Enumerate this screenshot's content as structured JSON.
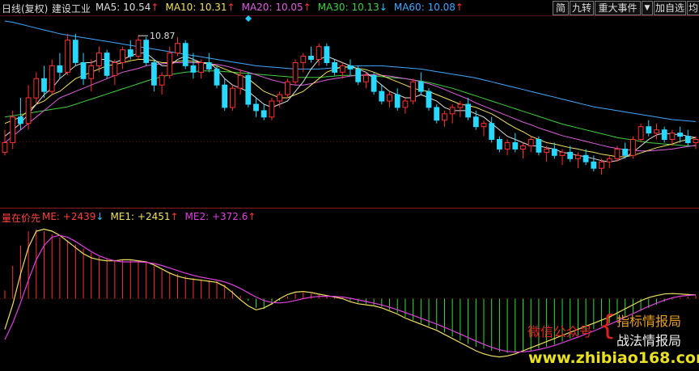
{
  "header": {
    "period": "日线(复权)",
    "stock_name": "建设工业",
    "ma": [
      {
        "label": "MA5:",
        "value": "10.54",
        "dir": "up",
        "color": "#dddddd"
      },
      {
        "label": "MA10:",
        "value": "10.31",
        "dir": "up",
        "color": "#f0e060"
      },
      {
        "label": "MA20:",
        "value": "10.05",
        "dir": "up",
        "color": "#e060e0"
      },
      {
        "label": "MA30:",
        "value": "10.13",
        "dir": "down",
        "color": "#40d040"
      },
      {
        "label": "MA60:",
        "value": "10.08",
        "dir": "up",
        "color": "#40a8ff"
      }
    ]
  },
  "toolbar": {
    "jian": "简",
    "jiuzhuan": "九转",
    "events": "重大事件",
    "add_watch": "加自选",
    "misc": "均"
  },
  "sub_panel": {
    "title": "量在价先",
    "items": [
      {
        "label": "ME:",
        "value": "+2439",
        "dir": "down",
        "color": "#ff4040"
      },
      {
        "label": "ME1:",
        "value": "+2451",
        "dir": "up",
        "color": "#f0e060"
      },
      {
        "label": "ME2:",
        "value": "+372.6",
        "dir": "up",
        "color": "#e040e0"
      }
    ]
  },
  "watermark": {
    "wechat": "微信公众号",
    "brace": "{",
    "line1": "指标情报局",
    "line2": "战法情报局",
    "site": "www.zhibiao168.com"
  },
  "chart_data": {
    "type": "candlestick",
    "annotation": "10.87",
    "colors": {
      "up": "#ff3030",
      "down": "#28d8ff",
      "ma5": "#dddddd",
      "ma10": "#f0e060",
      "ma20": "#e060e0",
      "ma30": "#40d040",
      "ma60": "#40a8ff"
    },
    "candles": [
      [
        9.05,
        9.4,
        9.0,
        9.2
      ],
      [
        9.2,
        9.7,
        9.1,
        9.6
      ],
      [
        9.6,
        9.9,
        9.4,
        9.5
      ],
      [
        9.5,
        10.1,
        9.4,
        9.9
      ],
      [
        9.9,
        10.3,
        9.8,
        10.2
      ],
      [
        10.2,
        10.4,
        9.9,
        10.0
      ],
      [
        10.0,
        10.5,
        9.95,
        10.4
      ],
      [
        10.4,
        10.6,
        10.2,
        10.3
      ],
      [
        10.3,
        10.9,
        10.25,
        10.8
      ],
      [
        10.8,
        10.9,
        10.4,
        10.45
      ],
      [
        10.45,
        10.6,
        10.1,
        10.2
      ],
      [
        10.2,
        10.5,
        10.0,
        10.4
      ],
      [
        10.4,
        10.7,
        10.3,
        10.6
      ],
      [
        10.6,
        10.65,
        10.2,
        10.25
      ],
      [
        10.25,
        10.5,
        10.1,
        10.45
      ],
      [
        10.45,
        10.7,
        10.35,
        10.65
      ],
      [
        10.65,
        10.8,
        10.5,
        10.55
      ],
      [
        10.55,
        10.87,
        10.5,
        10.8
      ],
      [
        10.8,
        10.85,
        10.4,
        10.45
      ],
      [
        10.45,
        10.5,
        10.0,
        10.1
      ],
      [
        10.1,
        10.3,
        9.95,
        10.25
      ],
      [
        10.25,
        10.7,
        10.2,
        10.6
      ],
      [
        10.6,
        10.85,
        10.55,
        10.75
      ],
      [
        10.75,
        10.8,
        10.35,
        10.4
      ],
      [
        10.4,
        10.6,
        10.2,
        10.3
      ],
      [
        10.3,
        10.5,
        10.2,
        10.45
      ],
      [
        10.45,
        10.6,
        10.3,
        10.35
      ],
      [
        10.35,
        10.4,
        10.05,
        10.1
      ],
      [
        10.1,
        10.2,
        9.7,
        9.75
      ],
      [
        9.75,
        10.1,
        9.7,
        10.05
      ],
      [
        10.05,
        10.35,
        9.95,
        10.25
      ],
      [
        10.25,
        10.3,
        9.75,
        9.8
      ],
      [
        9.8,
        9.9,
        9.6,
        9.7
      ],
      [
        9.7,
        9.8,
        9.55,
        9.6
      ],
      [
        9.6,
        9.9,
        9.55,
        9.85
      ],
      [
        9.85,
        10.0,
        9.75,
        9.95
      ],
      [
        9.95,
        10.2,
        9.9,
        10.15
      ],
      [
        10.15,
        10.5,
        10.1,
        10.45
      ],
      [
        10.45,
        10.6,
        10.3,
        10.55
      ],
      [
        10.55,
        10.7,
        10.45,
        10.5
      ],
      [
        10.5,
        10.75,
        10.4,
        10.7
      ],
      [
        10.7,
        10.75,
        10.4,
        10.45
      ],
      [
        10.45,
        10.5,
        10.25,
        10.3
      ],
      [
        10.3,
        10.45,
        10.2,
        10.4
      ],
      [
        10.4,
        10.5,
        10.25,
        10.35
      ],
      [
        10.35,
        10.4,
        10.1,
        10.15
      ],
      [
        10.15,
        10.3,
        10.05,
        10.25
      ],
      [
        10.25,
        10.3,
        9.95,
        10.0
      ],
      [
        10.0,
        10.1,
        9.8,
        9.85
      ],
      [
        9.85,
        10.0,
        9.75,
        9.95
      ],
      [
        9.95,
        10.05,
        9.7,
        9.75
      ],
      [
        9.75,
        9.9,
        9.65,
        9.85
      ],
      [
        9.85,
        10.2,
        9.8,
        10.15
      ],
      [
        10.15,
        10.3,
        9.95,
        10.0
      ],
      [
        10.0,
        10.05,
        9.7,
        9.75
      ],
      [
        9.75,
        9.8,
        9.5,
        9.55
      ],
      [
        9.55,
        9.7,
        9.45,
        9.65
      ],
      [
        9.65,
        9.8,
        9.5,
        9.75
      ],
      [
        9.75,
        9.85,
        9.6,
        9.8
      ],
      [
        9.8,
        9.9,
        9.55,
        9.6
      ],
      [
        9.6,
        9.7,
        9.4,
        9.45
      ],
      [
        9.45,
        9.55,
        9.3,
        9.5
      ],
      [
        9.5,
        9.6,
        9.2,
        9.25
      ],
      [
        9.25,
        9.3,
        9.05,
        9.1
      ],
      [
        9.1,
        9.25,
        9.0,
        9.2
      ],
      [
        9.2,
        9.35,
        9.05,
        9.1
      ],
      [
        9.1,
        9.2,
        8.95,
        9.15
      ],
      [
        9.15,
        9.3,
        9.05,
        9.25
      ],
      [
        9.25,
        9.3,
        9.0,
        9.05
      ],
      [
        9.05,
        9.15,
        8.9,
        9.1
      ],
      [
        9.1,
        9.2,
        8.95,
        9.0
      ],
      [
        9.0,
        9.1,
        8.85,
        9.05
      ],
      [
        9.05,
        9.15,
        8.9,
        8.95
      ],
      [
        8.95,
        9.05,
        8.8,
        9.0
      ],
      [
        9.0,
        9.1,
        8.85,
        8.9
      ],
      [
        8.9,
        9.0,
        8.75,
        8.8
      ],
      [
        8.8,
        8.95,
        8.7,
        8.9
      ],
      [
        8.9,
        9.0,
        8.8,
        8.95
      ],
      [
        8.95,
        9.15,
        8.9,
        9.1
      ],
      [
        9.1,
        9.2,
        8.95,
        9.0
      ],
      [
        9.0,
        9.3,
        8.95,
        9.25
      ],
      [
        9.25,
        9.5,
        9.2,
        9.45
      ],
      [
        9.45,
        9.55,
        9.3,
        9.35
      ],
      [
        9.35,
        9.5,
        9.25,
        9.4
      ],
      [
        9.4,
        9.45,
        9.2,
        9.25
      ],
      [
        9.25,
        9.4,
        9.15,
        9.35
      ],
      [
        9.35,
        9.45,
        9.2,
        9.3
      ],
      [
        9.3,
        9.4,
        9.15,
        9.2
      ],
      [
        9.2,
        9.3,
        9.1,
        9.25
      ]
    ],
    "ma5": [
      9.3,
      9.4,
      9.5,
      9.65,
      9.8,
      9.95,
      10.05,
      10.2,
      10.3,
      10.4,
      10.45,
      10.45,
      10.5,
      10.5,
      10.45,
      10.5,
      10.55,
      10.6,
      10.6,
      10.5,
      10.4,
      10.4,
      10.5,
      10.55,
      10.5,
      10.45,
      10.45,
      10.35,
      10.2,
      10.1,
      10.05,
      10.0,
      9.9,
      9.8,
      9.75,
      9.8,
      9.85,
      10.0,
      10.15,
      10.35,
      10.5,
      10.55,
      10.5,
      10.45,
      10.4,
      10.35,
      10.3,
      10.2,
      10.1,
      10.0,
      9.95,
      9.9,
      9.9,
      9.95,
      9.9,
      9.85,
      9.75,
      9.7,
      9.7,
      9.7,
      9.65,
      9.6,
      9.5,
      9.4,
      9.3,
      9.25,
      9.2,
      9.15,
      9.15,
      9.12,
      9.1,
      9.05,
      9.03,
      9.0,
      8.98,
      8.95,
      8.92,
      8.9,
      8.92,
      8.97,
      9.05,
      9.15,
      9.25,
      9.32,
      9.35,
      9.33,
      9.33,
      9.3,
      9.28
    ],
    "ma10": [
      9.5,
      9.55,
      9.6,
      9.7,
      9.8,
      9.85,
      9.95,
      10.0,
      10.1,
      10.2,
      10.25,
      10.3,
      10.35,
      10.4,
      10.42,
      10.45,
      10.48,
      10.5,
      10.5,
      10.48,
      10.45,
      10.45,
      10.47,
      10.48,
      10.47,
      10.45,
      10.43,
      10.4,
      10.35,
      10.3,
      10.25,
      10.2,
      10.1,
      10.0,
      9.95,
      9.9,
      9.9,
      9.95,
      10.0,
      10.1,
      10.2,
      10.3,
      10.35,
      10.38,
      10.38,
      10.36,
      10.34,
      10.3,
      10.25,
      10.2,
      10.15,
      10.1,
      10.05,
      10.02,
      10.0,
      9.95,
      9.9,
      9.85,
      9.8,
      9.78,
      9.75,
      9.7,
      9.65,
      9.58,
      9.5,
      9.43,
      9.37,
      9.3,
      9.25,
      9.2,
      9.18,
      9.15,
      9.12,
      9.1,
      9.07,
      9.05,
      9.02,
      9.0,
      8.98,
      8.98,
      9.0,
      9.04,
      9.08,
      9.12,
      9.15,
      9.18,
      9.22,
      9.25,
      9.28
    ],
    "ma20": [
      9.2,
      9.3,
      9.4,
      9.5,
      9.6,
      9.7,
      9.8,
      9.9,
      9.95,
      10.0,
      10.05,
      10.1,
      10.15,
      10.2,
      10.25,
      10.3,
      10.33,
      10.36,
      10.4,
      10.42,
      10.43,
      10.44,
      10.45,
      10.45,
      10.45,
      10.44,
      10.43,
      10.42,
      10.4,
      10.37,
      10.33,
      10.3,
      10.26,
      10.22,
      10.18,
      10.15,
      10.12,
      10.1,
      10.1,
      10.12,
      10.15,
      10.18,
      10.2,
      10.22,
      10.24,
      10.25,
      10.26,
      10.26,
      10.25,
      10.24,
      10.22,
      10.2,
      10.18,
      10.15,
      10.12,
      10.08,
      10.03,
      9.98,
      9.93,
      9.88,
      9.82,
      9.77,
      9.72,
      9.67,
      9.62,
      9.57,
      9.52,
      9.48,
      9.43,
      9.39,
      9.35,
      9.31,
      9.28,
      9.25,
      9.22,
      9.19,
      9.16,
      9.13,
      9.11,
      9.09,
      9.08,
      9.07,
      9.07,
      9.08,
      9.09,
      9.1,
      9.12,
      9.14,
      9.16
    ],
    "ma30": [
      9.6,
      9.62,
      9.64,
      9.66,
      9.68,
      9.7,
      9.72,
      9.74,
      9.76,
      9.8,
      9.84,
      9.88,
      9.92,
      9.96,
      10.0,
      10.04,
      10.08,
      10.12,
      10.16,
      10.2,
      10.23,
      10.26,
      10.28,
      10.3,
      10.31,
      10.32,
      10.32,
      10.32,
      10.31,
      10.3,
      10.29,
      10.28,
      10.27,
      10.26,
      10.25,
      10.24,
      10.23,
      10.22,
      10.22,
      10.22,
      10.22,
      10.23,
      10.24,
      10.25,
      10.25,
      10.25,
      10.25,
      10.24,
      10.23,
      10.22,
      10.21,
      10.2,
      10.18,
      10.16,
      10.14,
      10.11,
      10.08,
      10.05,
      10.01,
      9.97,
      9.93,
      9.89,
      9.85,
      9.81,
      9.77,
      9.73,
      9.69,
      9.65,
      9.61,
      9.57,
      9.53,
      9.49,
      9.46,
      9.43,
      9.4,
      9.37,
      9.34,
      9.31,
      9.28,
      9.26,
      9.24,
      9.22,
      9.2,
      9.19,
      9.18,
      9.17,
      9.16,
      9.15,
      9.15
    ],
    "ma60": [
      11.1,
      11.08,
      11.05,
      11.02,
      10.99,
      10.96,
      10.93,
      10.9,
      10.88,
      10.86,
      10.84,
      10.82,
      10.8,
      10.78,
      10.76,
      10.74,
      10.72,
      10.7,
      10.68,
      10.66,
      10.64,
      10.62,
      10.6,
      10.58,
      10.56,
      10.54,
      10.52,
      10.5,
      10.48,
      10.46,
      10.44,
      10.42,
      10.4,
      10.39,
      10.38,
      10.37,
      10.36,
      10.35,
      10.35,
      10.35,
      10.35,
      10.36,
      10.37,
      10.38,
      10.39,
      10.4,
      10.4,
      10.4,
      10.4,
      10.39,
      10.38,
      10.37,
      10.36,
      10.35,
      10.33,
      10.31,
      10.29,
      10.27,
      10.25,
      10.23,
      10.21,
      10.18,
      10.15,
      10.12,
      10.09,
      10.06,
      10.03,
      10.0,
      9.97,
      9.94,
      9.91,
      9.88,
      9.85,
      9.82,
      9.79,
      9.76,
      9.74,
      9.72,
      9.7,
      9.68,
      9.66,
      9.64,
      9.62,
      9.6,
      9.58,
      9.56,
      9.55,
      9.54,
      9.53
    ],
    "me_hist": [
      400,
      1600,
      2600,
      3300,
      3400,
      3300,
      3150,
      3000,
      2850,
      2650,
      2450,
      2250,
      2050,
      1950,
      1900,
      1900,
      1900,
      1850,
      1800,
      1600,
      1400,
      1300,
      1200,
      1100,
      1000,
      950,
      900,
      850,
      700,
      400,
      150,
      -100,
      -450,
      -500,
      -300,
      -100,
      100,
      250,
      300,
      250,
      200,
      120,
      80,
      40,
      -100,
      -200,
      -250,
      -300,
      -400,
      -550,
      -700,
      -900,
      -1050,
      -1200,
      -1350,
      -1500,
      -1650,
      -1850,
      -2050,
      -2200,
      -2350,
      -2450,
      -2550,
      -2600,
      -2650,
      -2650,
      -2600,
      -2550,
      -2450,
      -2350,
      -2250,
      -2100,
      -1950,
      -1800,
      -1650,
      -1500,
      -1350,
      -1200,
      -1050,
      -900,
      -750,
      -600,
      -450,
      -300,
      -150,
      -50,
      50,
      100,
      150
    ],
    "me1": [
      -1500,
      -300,
      1200,
      2500,
      3300,
      3400,
      3300,
      3100,
      2800,
      2500,
      2200,
      2000,
      1900,
      1850,
      1850,
      1900,
      1900,
      1850,
      1800,
      1650,
      1450,
      1250,
      1100,
      1000,
      950,
      900,
      850,
      800,
      600,
      300,
      -50,
      -350,
      -550,
      -450,
      -250,
      0,
      200,
      320,
      350,
      300,
      220,
      150,
      80,
      0,
      -150,
      -250,
      -300,
      -350,
      -450,
      -600,
      -750,
      -950,
      -1100,
      -1250,
      -1400,
      -1550,
      -1750,
      -1950,
      -2150,
      -2350,
      -2550,
      -2700,
      -2800,
      -2850,
      -2800,
      -2700,
      -2550,
      -2400,
      -2250,
      -2100,
      -1950,
      -1800,
      -1650,
      -1500,
      -1350,
      -1200,
      -1050,
      -900,
      -700,
      -500,
      -300,
      -100,
      50,
      150,
      230,
      250,
      230,
      200,
      180
    ],
    "me2": [
      -2000,
      -1200,
      -200,
      900,
      1900,
      2600,
      3000,
      3100,
      3000,
      2800,
      2550,
      2300,
      2100,
      1950,
      1850,
      1800,
      1800,
      1800,
      1780,
      1720,
      1620,
      1500,
      1370,
      1250,
      1140,
      1050,
      980,
      910,
      820,
      680,
      500,
      290,
      80,
      -90,
      -190,
      -210,
      -170,
      -90,
      0,
      70,
      110,
      120,
      110,
      80,
      20,
      -60,
      -140,
      -220,
      -310,
      -420,
      -540,
      -680,
      -820,
      -960,
      -1100,
      -1250,
      -1400,
      -1560,
      -1730,
      -1900,
      -2070,
      -2230,
      -2380,
      -2500,
      -2580,
      -2610,
      -2600,
      -2560,
      -2490,
      -2400,
      -2290,
      -2160,
      -2020,
      -1880,
      -1730,
      -1580,
      -1420,
      -1260,
      -1090,
      -910,
      -730,
      -550,
      -380,
      -220,
      -80,
      40,
      120,
      160,
      180
    ]
  }
}
